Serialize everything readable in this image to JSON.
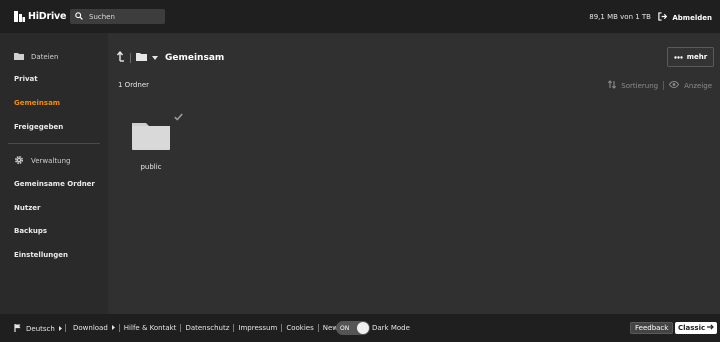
{
  "header": {
    "logo_text": "HiDrive",
    "search_placeholder": "Suchen",
    "quota": "89,1 MB von 1 TB",
    "logout_label": "Abmelden"
  },
  "sidebar": {
    "files_heading": "Dateien",
    "files_items": [
      {
        "label": "Privat",
        "active": false
      },
      {
        "label": "Gemeinsam",
        "active": true
      },
      {
        "label": "Freigegeben",
        "active": false
      }
    ],
    "admin_heading": "Verwaltung",
    "admin_items": [
      {
        "label": "Gemeinsame Ordner"
      },
      {
        "label": "Nutzer"
      },
      {
        "label": "Backups"
      },
      {
        "label": "Einstellungen"
      }
    ]
  },
  "main": {
    "current_folder": "Gemeinsam",
    "more_label": "mehr",
    "item_count": "1 Ordner",
    "sort_label": "Sortierung",
    "view_label": "Anzeige",
    "items": [
      {
        "name": "public",
        "type": "folder",
        "selected": true
      }
    ]
  },
  "footer": {
    "language": "Deutsch",
    "links": [
      "Download",
      "Hilfe & Kontakt",
      "Datenschutz",
      "Impressum",
      "Cookies",
      "News"
    ],
    "toggle_state": "ON",
    "dark_mode_label": "Dark Mode",
    "feedback_label": "Feedback",
    "classic_label": "Classic"
  },
  "colors": {
    "accent": "#f28c00",
    "topbar_bg": "#1f1f1f",
    "sidebar_bg": "#2a2a2a",
    "main_bg": "#303030"
  },
  "icons": [
    "hidrive-logo-icon",
    "search-icon",
    "logout-icon",
    "folder-icon",
    "gear-icon",
    "up-arrow-icon",
    "dropdown-caret-icon",
    "sort-icon",
    "eye-icon",
    "check-icon",
    "flag-icon",
    "more-dots-icon",
    "arrow-right-icon"
  ]
}
